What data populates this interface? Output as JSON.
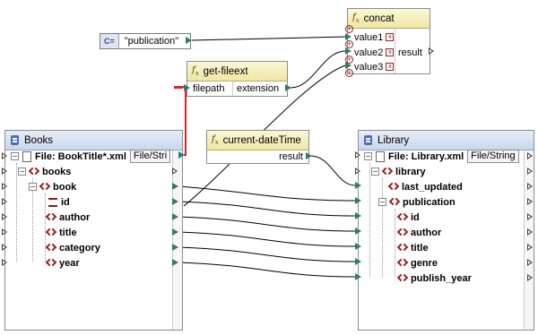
{
  "constant": {
    "icon_label": "C=",
    "value": "\"publication\""
  },
  "concat": {
    "title": "concat",
    "inputs": [
      "value1",
      "value2",
      "value3"
    ],
    "output": "result"
  },
  "get_fileext": {
    "title": "get-fileext",
    "input": "filepath",
    "output": "extension"
  },
  "current_datetime": {
    "title": "current-dateTime",
    "output": "result"
  },
  "books": {
    "title": "Books",
    "file_label": "File: BookTitle*.xml",
    "file_tag": "File/Stri",
    "nodes": [
      "books",
      "book",
      "id",
      "author",
      "title",
      "category",
      "year"
    ]
  },
  "library": {
    "title": "Library",
    "file_label": "File: Library.xml",
    "file_tag": "File/String",
    "nodes": [
      "library",
      "last_updated",
      "publication",
      "id",
      "author",
      "title",
      "genre",
      "publish_year"
    ]
  },
  "colors": {
    "connector": "#2e7d6a",
    "wire": "#000000",
    "filepath_wire": "#e0202a",
    "function_title": "#efe7a2",
    "component_title": "#c9d7eb",
    "element_icon": "#9a1f1f"
  }
}
